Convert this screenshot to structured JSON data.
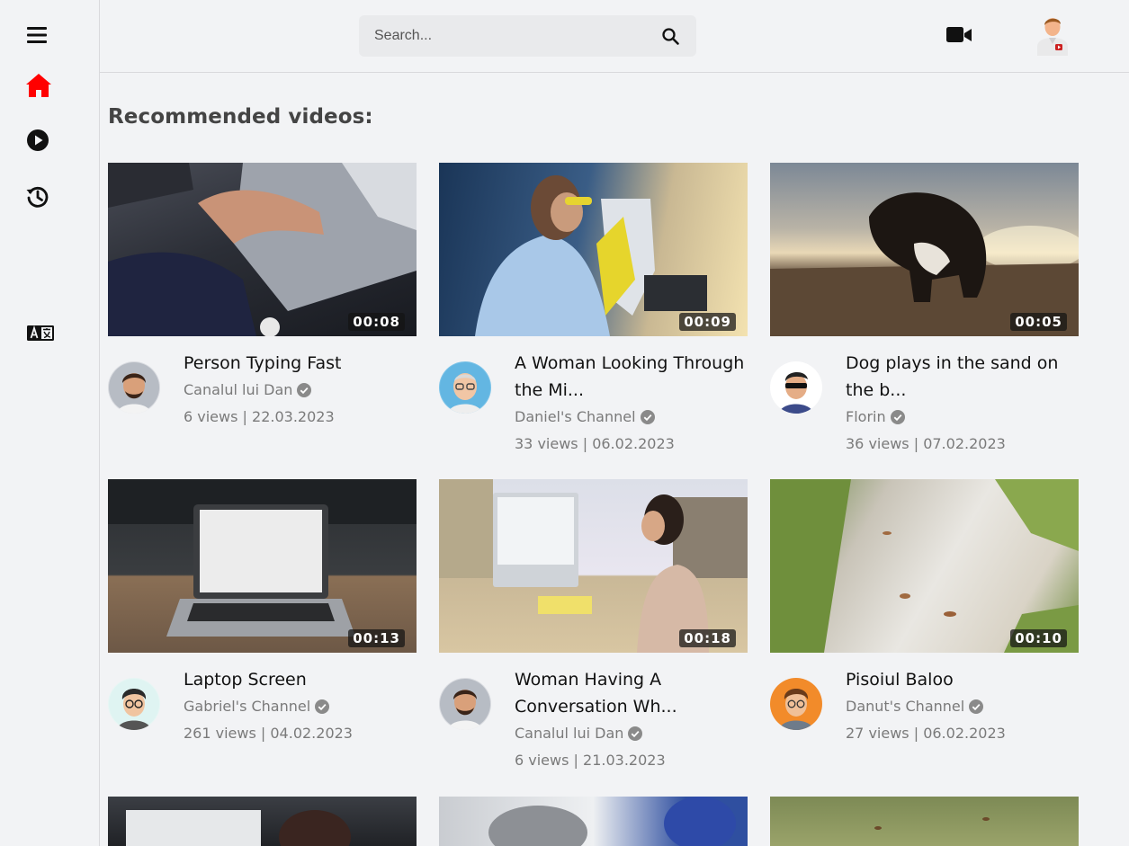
{
  "search": {
    "placeholder": "Search..."
  },
  "section_title": "Recommended videos:",
  "icons": {
    "menu": "hamburger-menu-icon",
    "home": "home-icon",
    "play": "play-circle-icon",
    "history": "history-icon",
    "language": "translate-icon",
    "search": "search-icon",
    "upload": "video-camera-icon"
  },
  "colors": {
    "accent": "#ff0000",
    "background": "#f2f3f5",
    "muted_text": "#7a7a7a"
  },
  "videos": [
    {
      "title": "Person Typing Fast",
      "channel": "Canalul lui Dan",
      "stats": "6 views | 22.03.2023",
      "duration": "00:08"
    },
    {
      "title": "A Woman Looking Through the Mi...",
      "channel": "Daniel's Channel",
      "stats": "33 views | 06.02.2023",
      "duration": "00:09"
    },
    {
      "title": "Dog plays in the sand on the b...",
      "channel": "Florin",
      "stats": "36 views | 07.02.2023",
      "duration": "00:05"
    },
    {
      "title": "Laptop Screen",
      "channel": "Gabriel's Channel",
      "stats": "261 views | 04.02.2023",
      "duration": "00:13"
    },
    {
      "title": "Woman Having A Conversation Wh...",
      "channel": "Canalul lui Dan",
      "stats": "6 views | 21.03.2023",
      "duration": "00:18"
    },
    {
      "title": "Pisoiul Baloo",
      "channel": "Danut's Channel",
      "stats": "27 views | 06.02.2023",
      "duration": "00:10"
    }
  ]
}
